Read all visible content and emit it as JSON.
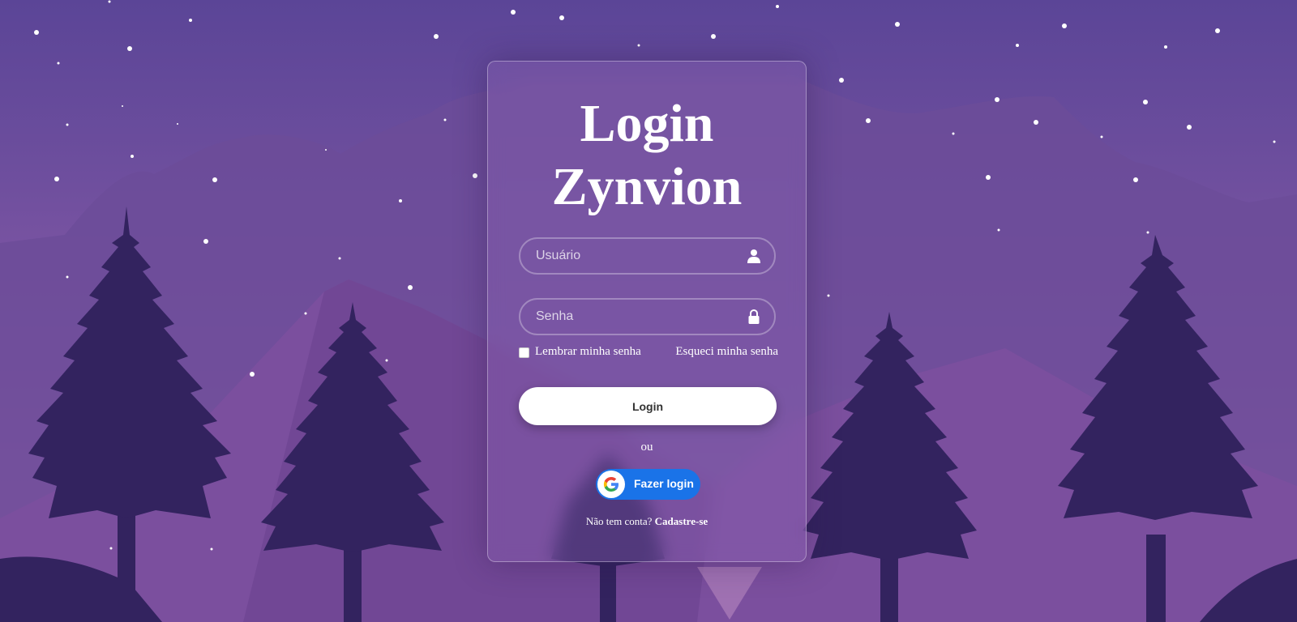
{
  "login": {
    "title_line1": "Login",
    "title_line2": "Zynvion",
    "username_placeholder": "Usuário",
    "password_placeholder": "Senha",
    "remember_label": "Lembrar minha senha",
    "forgot_label": "Esqueci minha senha",
    "login_button": "Login",
    "or_text": "ou",
    "google_button": "Fazer login",
    "no_account_text": "Não tem conta?",
    "signup_link": "Cadastre-se"
  },
  "icons": {
    "username": "user-icon",
    "password": "lock-icon",
    "google": "google-icon"
  },
  "colors": {
    "google_blue": "#1a73e8",
    "tree": "#33235f"
  }
}
